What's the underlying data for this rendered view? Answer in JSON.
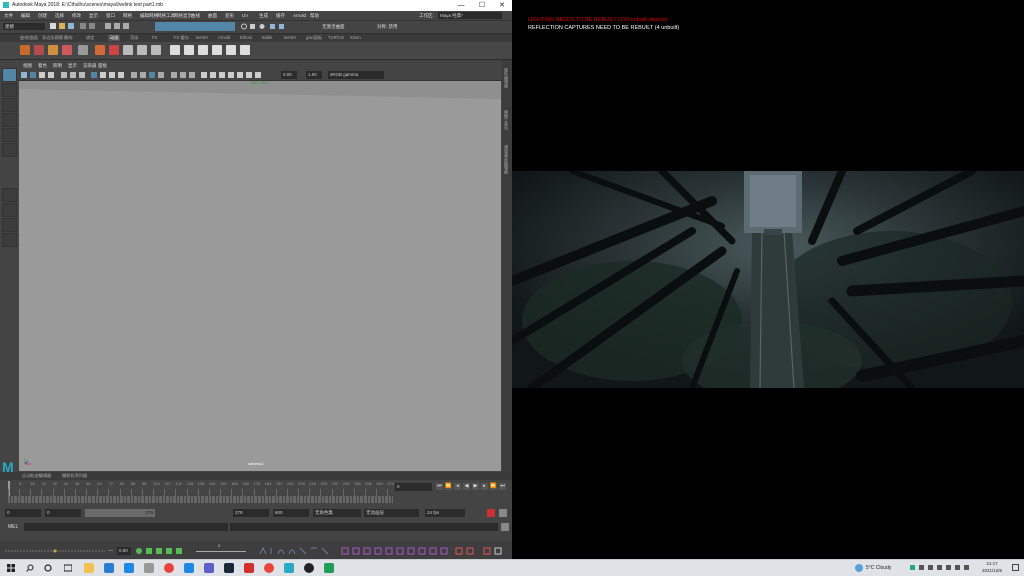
{
  "maya": {
    "window_title": "Autodesk Maya 2018: E:\\Cthulhu\\scenes\\maya\\livelink test part1.mb",
    "window_controls": {
      "minimize": "—",
      "maximize": "☐",
      "close": "✕"
    },
    "menu": [
      "文件",
      "编辑",
      "创建",
      "选择",
      "修改",
      "显示",
      "窗口",
      "网格",
      "编辑网格",
      "网格工具",
      "网格显示",
      "曲线",
      "曲面",
      "变形",
      "UV",
      "生成",
      "缓存",
      "Arnold",
      "帮助"
    ],
    "workspace_label": "工作区:",
    "workspace_value": "Maya 经典*",
    "mode_dropdown": "建模",
    "no_live_surface": "无激活曲面",
    "symmetry": "对称: 禁用",
    "shelf_tabs": [
      "曲线/曲面",
      "多边形建模",
      "雕刻",
      "绑定",
      "动画",
      "渲染",
      "FX",
      "FX 缓存",
      "MASH",
      "Arnold",
      "Bifrost",
      "Bullet",
      "MASH",
      "gaxi面板",
      "TURTLE",
      "XGen"
    ],
    "active_shelf_tab": "动画",
    "panel_menu": [
      "视图",
      "着色",
      "照明",
      "显示",
      "渲染器",
      "面板"
    ],
    "gamma_label": "sRGB gamma",
    "exposure_value": "0.00",
    "gamma_value": "1.00",
    "viewport_resolution_label": "960 x 540",
    "camera_label": "camera1",
    "right_strip_tabs": [
      "属性编辑器",
      "建模工具包",
      "通道盒/层编辑器"
    ],
    "time_tabs": [
      "运动轨迹编辑器",
      "摄影机序列器"
    ],
    "timeline_ticks": [
      "0",
      "8",
      "16",
      "24",
      "32",
      "40",
      "48",
      "56",
      "64",
      "72",
      "80",
      "88",
      "96",
      "104",
      "112",
      "120",
      "128",
      "136",
      "144",
      "152",
      "160",
      "168",
      "176",
      "184",
      "192",
      "200",
      "208",
      "216",
      "224",
      "232",
      "240",
      "248",
      "256",
      "264",
      "272"
    ],
    "current_frame": "0",
    "range_start": "0",
    "range_start2": "0",
    "range_slider_value": "279",
    "range_end": "279",
    "range_end2": "600",
    "no_character": "无角色集",
    "no_anim_layer": "无动画层",
    "fps": "24 fps",
    "mel_label": "MEL",
    "bottom_value": "0.50",
    "bottom_value2": "0"
  },
  "unreal": {
    "lighting_message": "LIGHTING NEEDS TO BE REBUILT (193 unbuilt objects)",
    "reflection_message": "REFLECTION CAPTURES NEED TO BE REBUILT (4 unbuilt)"
  },
  "taskbar": {
    "weather": "5°C Cloudy",
    "time": "21:17",
    "date": "2021/12/6"
  },
  "colors": {
    "maya_bg": "#444444",
    "viewport_gray": "#9a9a9a",
    "selected_blue": "#5285a6",
    "lighting_red": "#e00000"
  }
}
